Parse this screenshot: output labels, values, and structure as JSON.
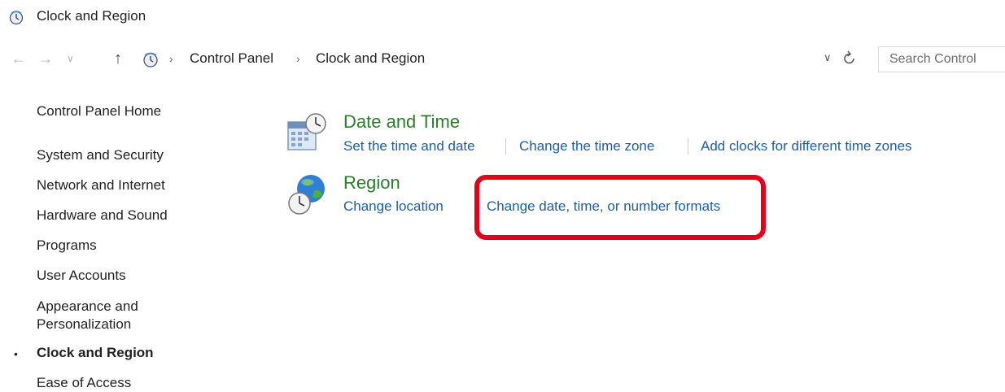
{
  "window": {
    "title": "Clock and Region",
    "icon": "clock-and-region-icon"
  },
  "navigation": {
    "back_icon": "back-arrow-icon",
    "forward_icon": "forward-arrow-icon",
    "recent_icon": "recent-dropdown-icon",
    "up_icon": "up-arrow-icon"
  },
  "address_bar": {
    "breadcrumbs": [
      "Control Panel",
      "Clock and Region"
    ],
    "separator": "›",
    "dropdown_icon": "chevron-down-icon",
    "refresh_icon": "refresh-icon"
  },
  "search": {
    "placeholder": "Search Control"
  },
  "sidebar": {
    "items": [
      {
        "label": "Control Panel Home",
        "active": false
      },
      {
        "label": "System and Security",
        "active": false
      },
      {
        "label": "Network and Internet",
        "active": false
      },
      {
        "label": "Hardware and Sound",
        "active": false
      },
      {
        "label": "Programs",
        "active": false
      },
      {
        "label": "User Accounts",
        "active": false
      },
      {
        "label": "Appearance and Personalization",
        "active": false
      },
      {
        "label": "Clock and Region",
        "active": true
      },
      {
        "label": "Ease of Access",
        "active": false
      }
    ],
    "active_bullet": "•"
  },
  "categories": [
    {
      "title": "Date and Time",
      "icon": "date-and-time-icon",
      "links": [
        "Set the time and date",
        "Change the time zone",
        "Add clocks for different time zones"
      ]
    },
    {
      "title": "Region",
      "icon": "region-globe-icon",
      "links": [
        "Change location",
        "Change date, time, or number formats"
      ]
    }
  ],
  "annotation": {
    "highlight_color": "#e4001b",
    "target": "Change date, time, or number formats"
  },
  "colors": {
    "link": "#1f5fa0",
    "category_title": "#2d7d2d"
  }
}
